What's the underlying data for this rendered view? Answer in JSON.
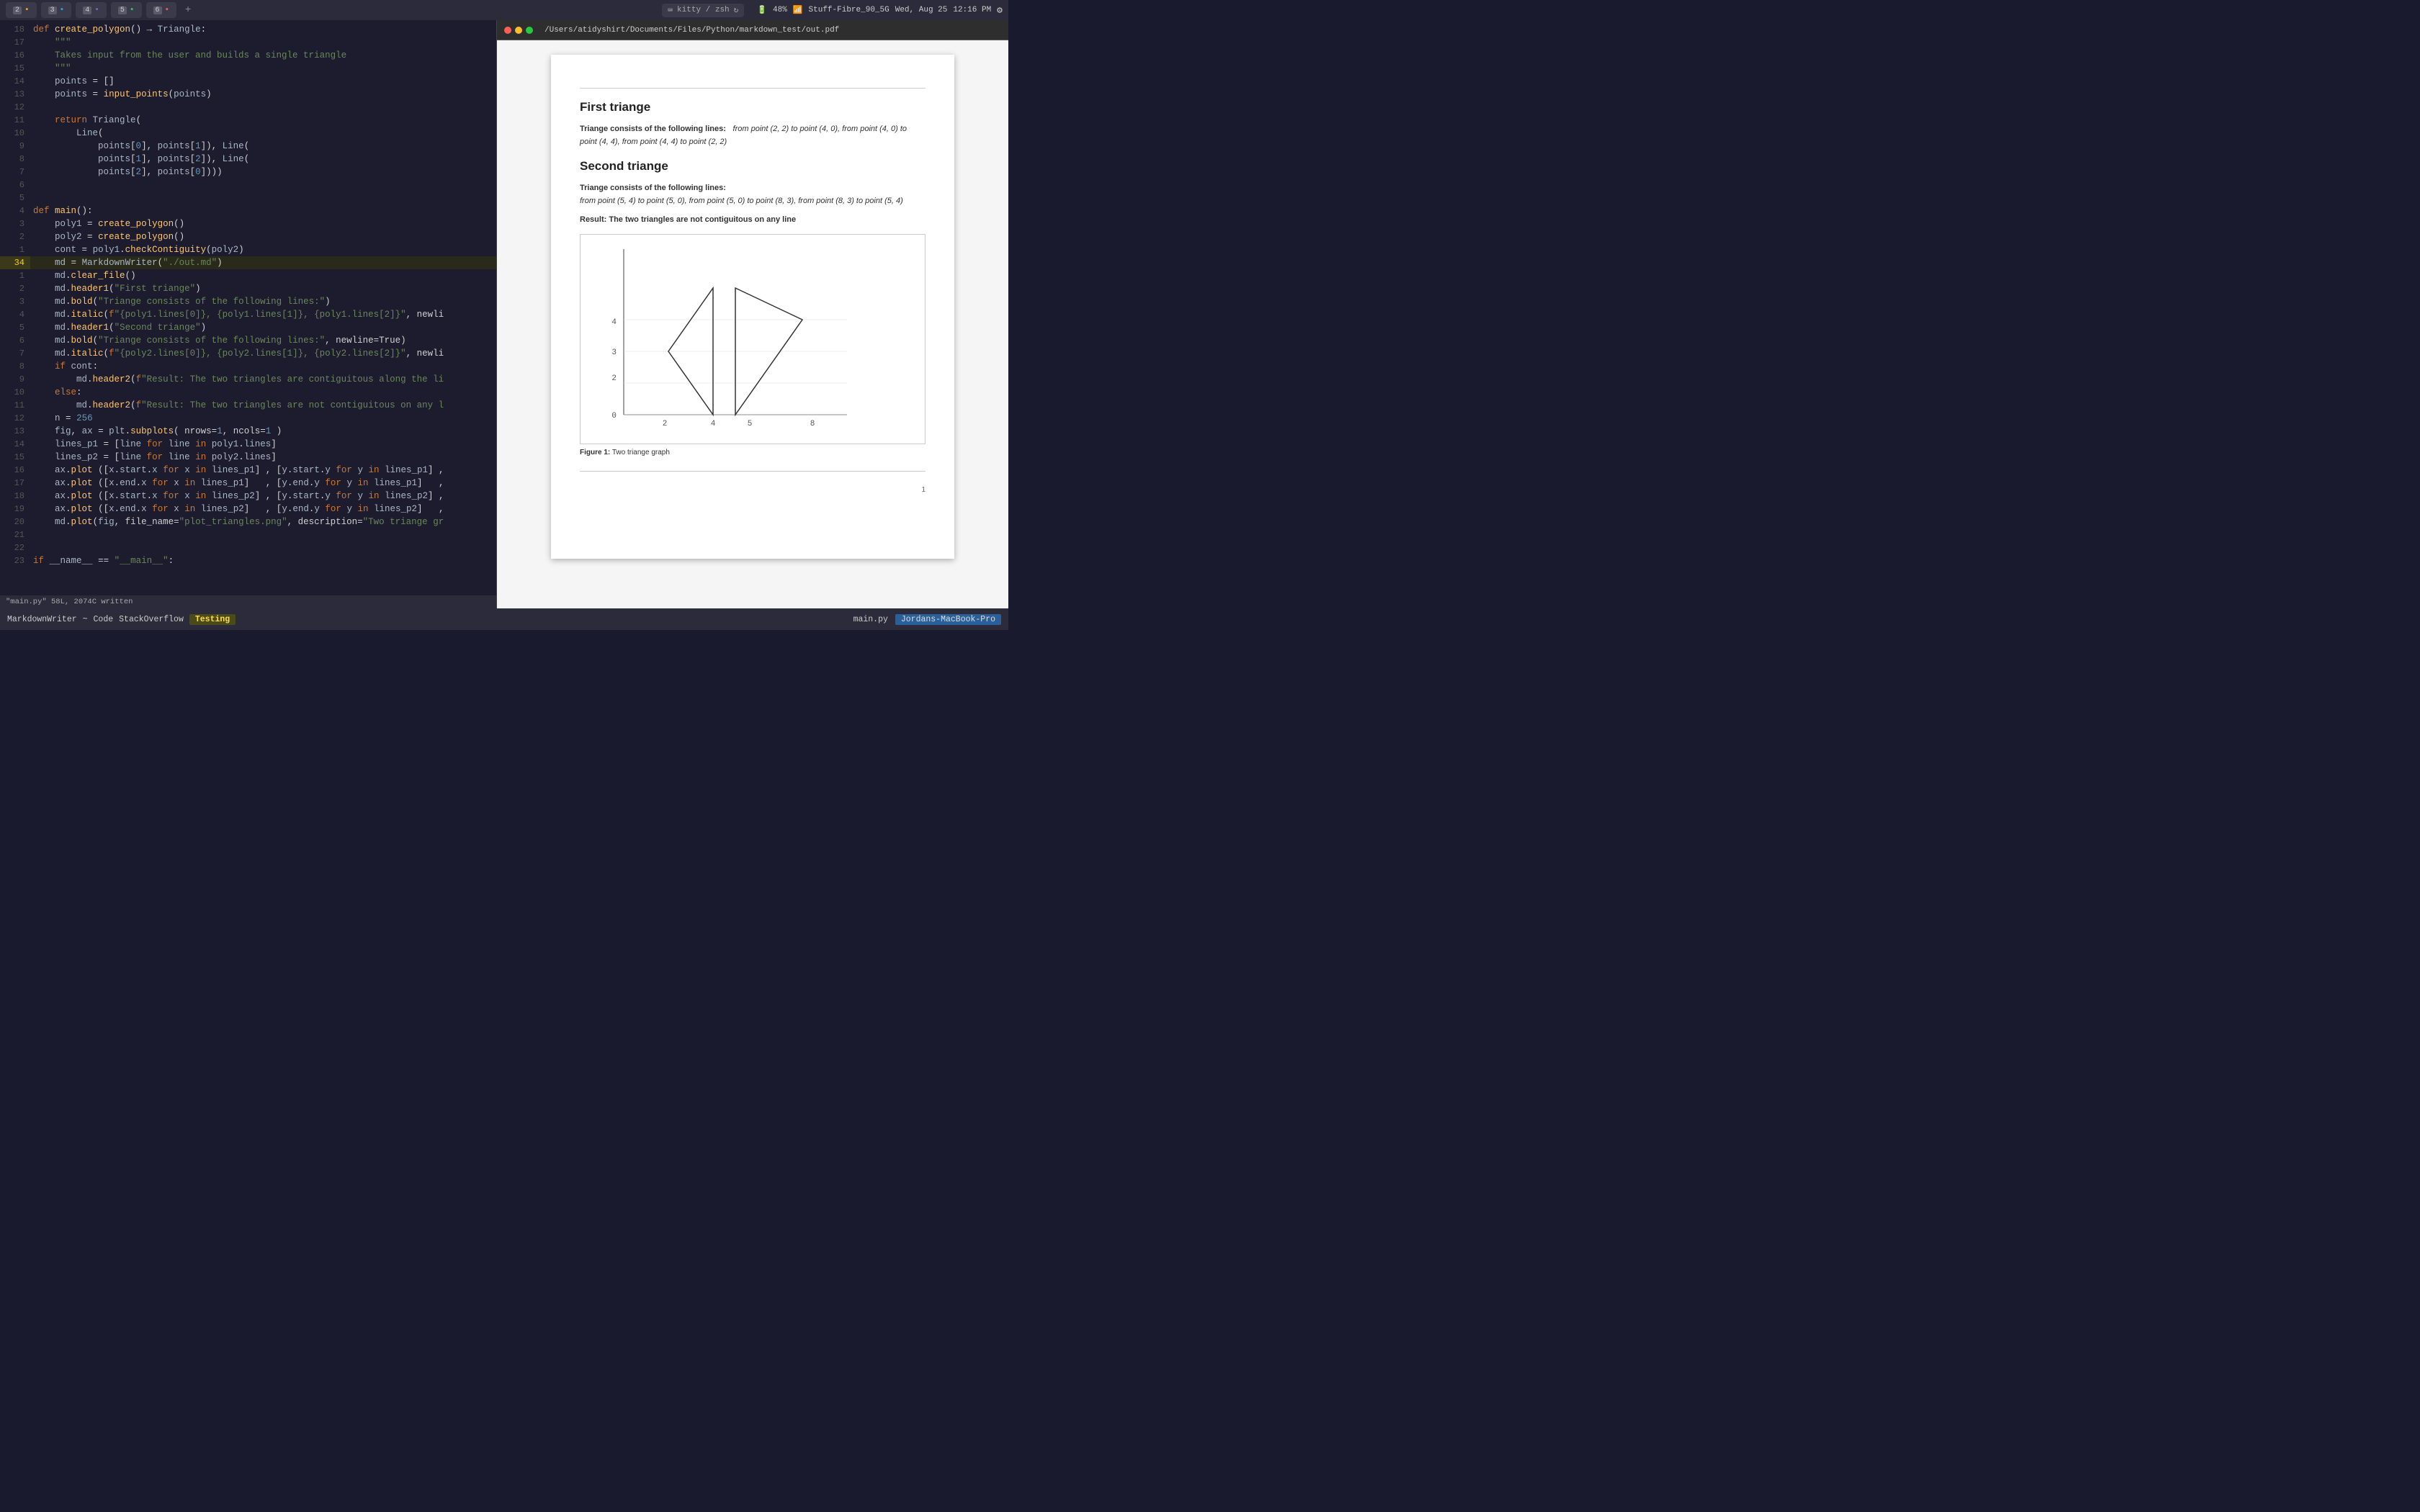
{
  "topbar": {
    "tabs": [
      {
        "num": "2",
        "icon_color": "#e8a030",
        "label": "",
        "active": false
      },
      {
        "num": "3",
        "icon_color": "#30a0e8",
        "label": "",
        "active": false
      },
      {
        "num": "4",
        "icon_color": "#8060c0",
        "label": "",
        "active": false
      },
      {
        "num": "5",
        "icon_color": "#30c860",
        "label": "",
        "active": false
      },
      {
        "num": "6",
        "icon_color": "#e86060",
        "label": "",
        "active": false
      }
    ],
    "kitty_label": "kitty / zsh",
    "battery": "48%",
    "wifi": "Stuff-Fibre_90_5G",
    "date": "Wed, Aug 25",
    "time": "12:16 PM"
  },
  "editor": {
    "lines": [
      {
        "num": "18",
        "content": "def create_polygon() → Triangle:",
        "type": "def"
      },
      {
        "num": "17",
        "content": "    \"\"\"",
        "type": "str"
      },
      {
        "num": "16",
        "content": "    Takes input from the user and builds a single triangle",
        "type": "cmt"
      },
      {
        "num": "15",
        "content": "    \"\"\"",
        "type": "str"
      },
      {
        "num": "14",
        "content": "    points = []",
        "type": "code"
      },
      {
        "num": "13",
        "content": "    points = input_points(points)",
        "type": "code"
      },
      {
        "num": "12",
        "content": "",
        "type": "empty"
      },
      {
        "num": "11",
        "content": "    return Triangle(",
        "type": "code"
      },
      {
        "num": "10",
        "content": "        Line(",
        "type": "code"
      },
      {
        "num": "9",
        "content": "            points[0], points[1]), Line(",
        "type": "code"
      },
      {
        "num": "8",
        "content": "            points[1], points[2]), Line(",
        "type": "code"
      },
      {
        "num": "7",
        "content": "            points[2], points[0]))",
        "type": "code"
      },
      {
        "num": "6",
        "content": "",
        "type": "empty"
      },
      {
        "num": "5",
        "content": "",
        "type": "empty"
      },
      {
        "num": "4",
        "content": "def main():",
        "type": "def"
      },
      {
        "num": "3",
        "content": "    poly1 = create_polygon()",
        "type": "code"
      },
      {
        "num": "2",
        "content": "    poly2 = create_polygon()",
        "type": "code"
      },
      {
        "num": "1",
        "content": "    cont = poly1.checkContiguity(poly2)",
        "type": "code"
      },
      {
        "num": "34",
        "content": "    md = MarkdownWriter(\"./out.md\")",
        "type": "code",
        "current": true
      },
      {
        "num": "1",
        "content": "    md.clear_file()",
        "type": "code"
      },
      {
        "num": "2",
        "content": "    md.header1(\"First triange\")",
        "type": "code"
      },
      {
        "num": "3",
        "content": "    md.bold(\"Triange consists of the following lines:\")",
        "type": "code"
      },
      {
        "num": "4",
        "content": "    md.italic(f\"{poly1.lines[0]}, {poly1.lines[1]}, {poly1.lines[2]}\", newli",
        "type": "code"
      },
      {
        "num": "5",
        "content": "    md.header1(\"Second triange\")",
        "type": "code"
      },
      {
        "num": "6",
        "content": "    md.bold(\"Triange consists of the following lines:\", newline=True)",
        "type": "code"
      },
      {
        "num": "7",
        "content": "    md.italic(f\"{poly2.lines[0]}, {poly2.lines[1]}, {poly2.lines[2]}\", newli",
        "type": "code"
      },
      {
        "num": "8",
        "content": "    if cont:",
        "type": "code"
      },
      {
        "num": "9",
        "content": "        md.header2(f\"Result: The two triangles are contiguitous along the li",
        "type": "code"
      },
      {
        "num": "10",
        "content": "    else:",
        "type": "code"
      },
      {
        "num": "11",
        "content": "        md.header2(f\"Result: The two triangles are not contiguitous on any l",
        "type": "code"
      },
      {
        "num": "12",
        "content": "    n = 256",
        "type": "code"
      },
      {
        "num": "13",
        "content": "    fig, ax = plt.subplots( nrows=1, ncols=1 )",
        "type": "code"
      },
      {
        "num": "14",
        "content": "    lines_p1 = [line for line in poly1.lines]",
        "type": "code"
      },
      {
        "num": "15",
        "content": "    lines_p2 = [line for line in poly2.lines]",
        "type": "code"
      },
      {
        "num": "16",
        "content": "    ax.plot ([x.start.x for x in lines_p1] , [y.start.y for y in lines_p1] ,",
        "type": "code"
      },
      {
        "num": "17",
        "content": "    ax.plot ([x.end.x for x in lines_p1]   , [y.end.y for y in lines_p1]   ,",
        "type": "code"
      },
      {
        "num": "18",
        "content": "    ax.plot ([x.start.x for x in lines_p2] , [y.start.y for y in lines_p2] ,",
        "type": "code"
      },
      {
        "num": "19",
        "content": "    ax.plot ([x.end.x for x in lines_p2]   , [y.end.y for y in lines_p2]   ,",
        "type": "code"
      },
      {
        "num": "20",
        "content": "    md.plot(fig, file_name=\"plot_triangles.png\", description=\"Two triange gr",
        "type": "code"
      },
      {
        "num": "21",
        "content": "",
        "type": "empty"
      },
      {
        "num": "22",
        "content": "",
        "type": "empty"
      },
      {
        "num": "23",
        "content": "if __name__ == \"__main__\":",
        "type": "code"
      }
    ],
    "status_line": "\"main.py\" 58L, 2074C written"
  },
  "pdf": {
    "title_bar": "/Users/atidyshirt/Documents/Files/Python/markdown_test/out.pdf",
    "sections": [
      {
        "heading": "First triange",
        "bold_label": "Triange consists of the following lines:",
        "italic_text": "from point (2, 2) to point (4, 0), from point (4, 0) to point (4, 4), from point (4, 4) to point (2, 2)"
      },
      {
        "heading": "Second triange",
        "bold_label": "Triange consists of the following lines:",
        "italic_text": "from point (5, 4) to point (5, 0), from point (5, 0) to point (8, 3), from point (8, 3) to point (5, 4)"
      }
    ],
    "result": "Result: The two triangles are not contiguitous on any line",
    "chart": {
      "x_labels": [
        "2",
        "4",
        "5",
        "8"
      ],
      "y_labels": [
        "2",
        "0",
        "4",
        "3"
      ],
      "caption_bold": "Figure 1:",
      "caption_text": " Two triange graph"
    },
    "page_num": "1"
  },
  "bottombar": {
    "items": [
      "MarkdownWriter",
      "~",
      "Code",
      "StackOverflow"
    ],
    "active_tab": "Testing",
    "filename": "main.py",
    "hostname": "Jordans-MacBook-Pro"
  }
}
